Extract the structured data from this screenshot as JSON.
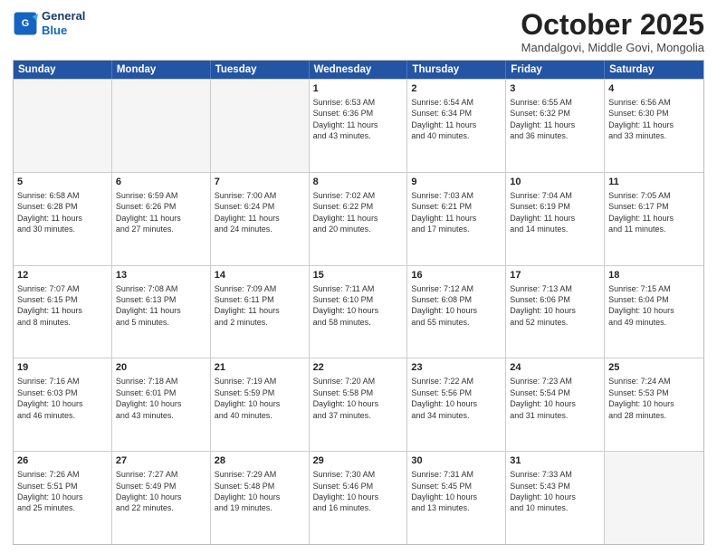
{
  "logo": {
    "line1": "General",
    "line2": "Blue"
  },
  "title": "October 2025",
  "subtitle": "Mandalgovi, Middle Govi, Mongolia",
  "days_of_week": [
    "Sunday",
    "Monday",
    "Tuesday",
    "Wednesday",
    "Thursday",
    "Friday",
    "Saturday"
  ],
  "weeks": [
    [
      {
        "day": "",
        "info": ""
      },
      {
        "day": "",
        "info": ""
      },
      {
        "day": "",
        "info": ""
      },
      {
        "day": "1",
        "info": "Sunrise: 6:53 AM\nSunset: 6:36 PM\nDaylight: 11 hours\nand 43 minutes."
      },
      {
        "day": "2",
        "info": "Sunrise: 6:54 AM\nSunset: 6:34 PM\nDaylight: 11 hours\nand 40 minutes."
      },
      {
        "day": "3",
        "info": "Sunrise: 6:55 AM\nSunset: 6:32 PM\nDaylight: 11 hours\nand 36 minutes."
      },
      {
        "day": "4",
        "info": "Sunrise: 6:56 AM\nSunset: 6:30 PM\nDaylight: 11 hours\nand 33 minutes."
      }
    ],
    [
      {
        "day": "5",
        "info": "Sunrise: 6:58 AM\nSunset: 6:28 PM\nDaylight: 11 hours\nand 30 minutes."
      },
      {
        "day": "6",
        "info": "Sunrise: 6:59 AM\nSunset: 6:26 PM\nDaylight: 11 hours\nand 27 minutes."
      },
      {
        "day": "7",
        "info": "Sunrise: 7:00 AM\nSunset: 6:24 PM\nDaylight: 11 hours\nand 24 minutes."
      },
      {
        "day": "8",
        "info": "Sunrise: 7:02 AM\nSunset: 6:22 PM\nDaylight: 11 hours\nand 20 minutes."
      },
      {
        "day": "9",
        "info": "Sunrise: 7:03 AM\nSunset: 6:21 PM\nDaylight: 11 hours\nand 17 minutes."
      },
      {
        "day": "10",
        "info": "Sunrise: 7:04 AM\nSunset: 6:19 PM\nDaylight: 11 hours\nand 14 minutes."
      },
      {
        "day": "11",
        "info": "Sunrise: 7:05 AM\nSunset: 6:17 PM\nDaylight: 11 hours\nand 11 minutes."
      }
    ],
    [
      {
        "day": "12",
        "info": "Sunrise: 7:07 AM\nSunset: 6:15 PM\nDaylight: 11 hours\nand 8 minutes."
      },
      {
        "day": "13",
        "info": "Sunrise: 7:08 AM\nSunset: 6:13 PM\nDaylight: 11 hours\nand 5 minutes."
      },
      {
        "day": "14",
        "info": "Sunrise: 7:09 AM\nSunset: 6:11 PM\nDaylight: 11 hours\nand 2 minutes."
      },
      {
        "day": "15",
        "info": "Sunrise: 7:11 AM\nSunset: 6:10 PM\nDaylight: 10 hours\nand 58 minutes."
      },
      {
        "day": "16",
        "info": "Sunrise: 7:12 AM\nSunset: 6:08 PM\nDaylight: 10 hours\nand 55 minutes."
      },
      {
        "day": "17",
        "info": "Sunrise: 7:13 AM\nSunset: 6:06 PM\nDaylight: 10 hours\nand 52 minutes."
      },
      {
        "day": "18",
        "info": "Sunrise: 7:15 AM\nSunset: 6:04 PM\nDaylight: 10 hours\nand 49 minutes."
      }
    ],
    [
      {
        "day": "19",
        "info": "Sunrise: 7:16 AM\nSunset: 6:03 PM\nDaylight: 10 hours\nand 46 minutes."
      },
      {
        "day": "20",
        "info": "Sunrise: 7:18 AM\nSunset: 6:01 PM\nDaylight: 10 hours\nand 43 minutes."
      },
      {
        "day": "21",
        "info": "Sunrise: 7:19 AM\nSunset: 5:59 PM\nDaylight: 10 hours\nand 40 minutes."
      },
      {
        "day": "22",
        "info": "Sunrise: 7:20 AM\nSunset: 5:58 PM\nDaylight: 10 hours\nand 37 minutes."
      },
      {
        "day": "23",
        "info": "Sunrise: 7:22 AM\nSunset: 5:56 PM\nDaylight: 10 hours\nand 34 minutes."
      },
      {
        "day": "24",
        "info": "Sunrise: 7:23 AM\nSunset: 5:54 PM\nDaylight: 10 hours\nand 31 minutes."
      },
      {
        "day": "25",
        "info": "Sunrise: 7:24 AM\nSunset: 5:53 PM\nDaylight: 10 hours\nand 28 minutes."
      }
    ],
    [
      {
        "day": "26",
        "info": "Sunrise: 7:26 AM\nSunset: 5:51 PM\nDaylight: 10 hours\nand 25 minutes."
      },
      {
        "day": "27",
        "info": "Sunrise: 7:27 AM\nSunset: 5:49 PM\nDaylight: 10 hours\nand 22 minutes."
      },
      {
        "day": "28",
        "info": "Sunrise: 7:29 AM\nSunset: 5:48 PM\nDaylight: 10 hours\nand 19 minutes."
      },
      {
        "day": "29",
        "info": "Sunrise: 7:30 AM\nSunset: 5:46 PM\nDaylight: 10 hours\nand 16 minutes."
      },
      {
        "day": "30",
        "info": "Sunrise: 7:31 AM\nSunset: 5:45 PM\nDaylight: 10 hours\nand 13 minutes."
      },
      {
        "day": "31",
        "info": "Sunrise: 7:33 AM\nSunset: 5:43 PM\nDaylight: 10 hours\nand 10 minutes."
      },
      {
        "day": "",
        "info": ""
      }
    ]
  ]
}
